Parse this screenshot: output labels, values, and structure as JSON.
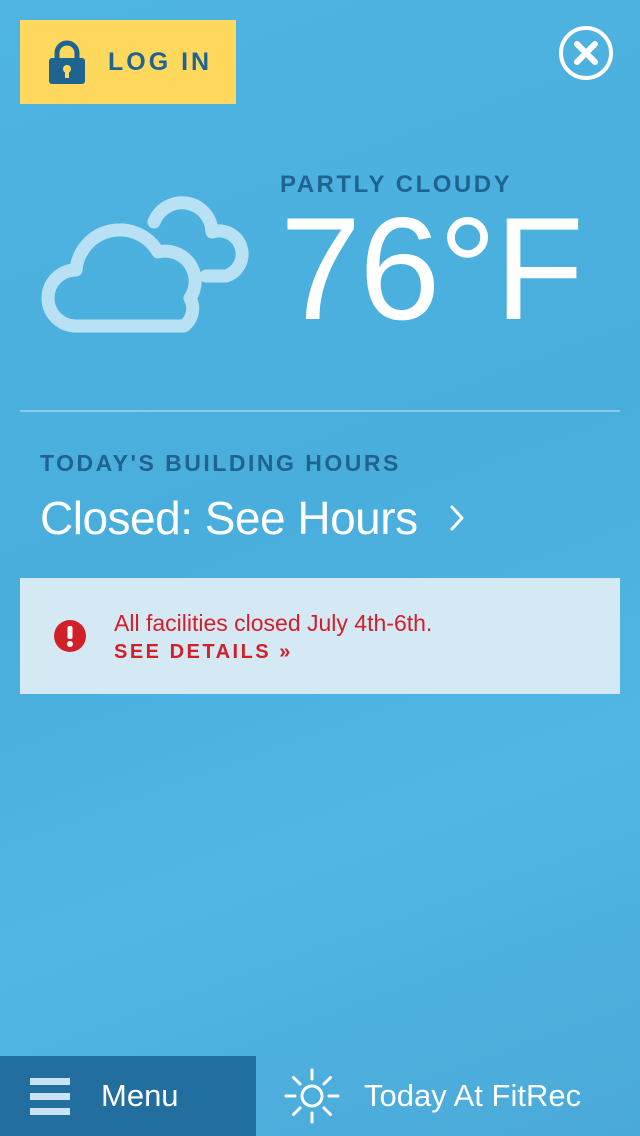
{
  "header": {
    "login_label": "LOG IN",
    "login_icon": "lock-icon",
    "close_icon": "close-icon"
  },
  "weather": {
    "icon": "partly-cloudy-icon",
    "condition": "PARTLY CLOUDY",
    "temperature": "76°F"
  },
  "hours": {
    "heading": "TODAY'S BUILDING HOURS",
    "status": "Closed: See Hours"
  },
  "alert": {
    "icon": "alert-icon",
    "message": "All facilities closed July 4th-6th.",
    "link_label": "SEE DETAILS »"
  },
  "bottom_nav": {
    "menu_label": "Menu",
    "menu_icon": "hamburger-icon",
    "today_label": "Today At FitRec",
    "today_icon": "sun-icon"
  },
  "colors": {
    "background": "#4fb4e2",
    "login_button": "#ffd85e",
    "accent_text": "#1f6391",
    "alert_background": "#d4e9f3",
    "alert_text": "#d0202a",
    "menu_bar": "#216e9f"
  }
}
